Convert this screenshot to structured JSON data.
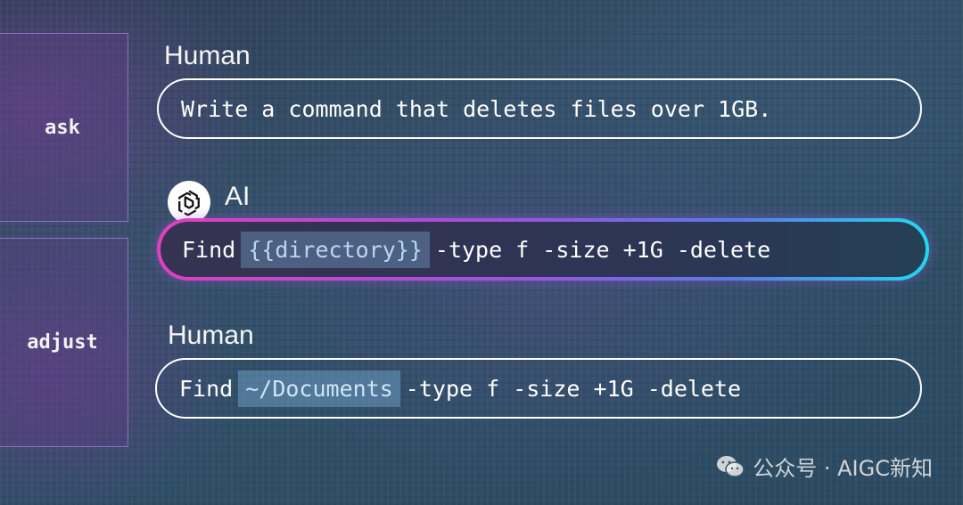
{
  "side_labels": {
    "ask": "ask",
    "adjust": "adjust"
  },
  "roles": {
    "human_1": "Human",
    "ai": "AI",
    "human_2": "Human"
  },
  "messages": {
    "human_prompt": "Write a command that deletes files over 1GB.",
    "ai_response": {
      "prefix": "Find",
      "variable": "{{directory}}",
      "suffix": "-type f -size +1G -delete"
    },
    "human_adjusted": {
      "prefix": "Find",
      "value": "~/Documents",
      "suffix": "-type f -size +1G -delete"
    }
  },
  "watermark": {
    "text": "公众号 · AIGC新知",
    "icon": "wechat-icon"
  },
  "colors": {
    "gradient_start": "#e040c0",
    "gradient_mid": "#a050e0",
    "gradient_end": "#20d8f0",
    "side_box_border": "#9678dc",
    "highlight": "#78aad2"
  },
  "icons": {
    "ai_logo": "openai-logo-icon"
  }
}
